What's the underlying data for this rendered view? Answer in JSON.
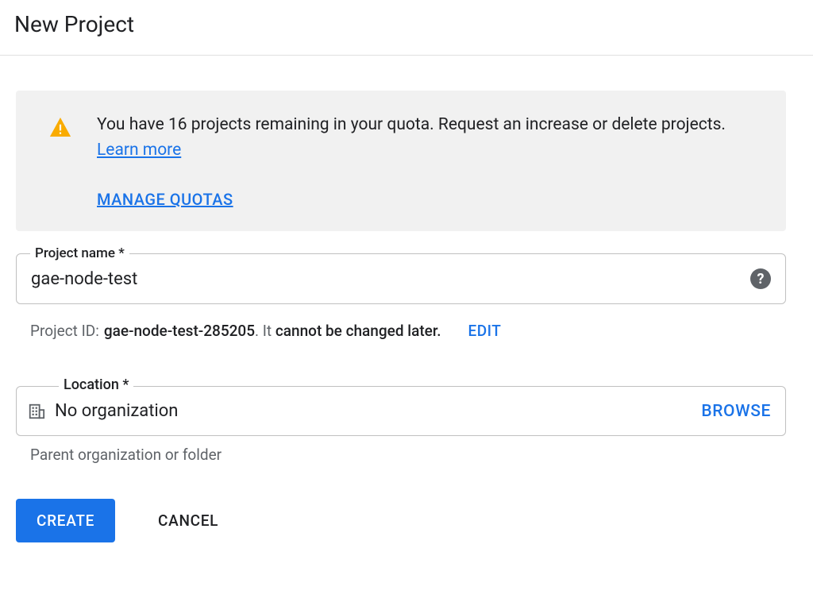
{
  "header": {
    "title": "New Project"
  },
  "notice": {
    "message_prefix": "You have ",
    "quota_count": "16",
    "message_mid": " projects remaining in your quota. Request an increase or delete projects. ",
    "learn_more": "Learn more",
    "manage_quotas": "MANAGE QUOTAS"
  },
  "project_name": {
    "label": "Project name *",
    "value": "gae-node-test"
  },
  "project_id": {
    "label": "Project ID:",
    "value": "gae-node-test-285205",
    "note_prefix": ". It ",
    "note_bold": "cannot be changed later.",
    "edit": "EDIT"
  },
  "location": {
    "label": "Location *",
    "value": "No organization",
    "browse": "BROWSE",
    "hint": "Parent organization or folder"
  },
  "actions": {
    "create": "CREATE",
    "cancel": "CANCEL"
  }
}
